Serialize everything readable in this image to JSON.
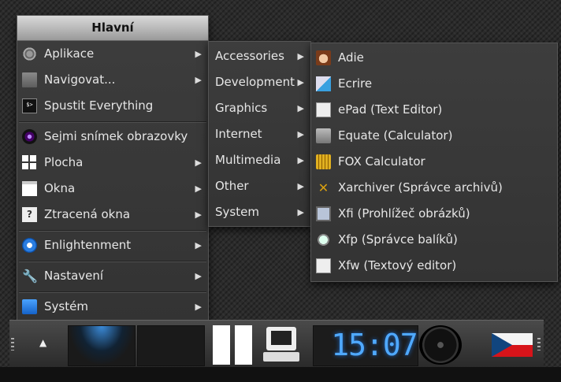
{
  "main_menu": {
    "title": "Hlavní",
    "items": [
      {
        "label": "Aplikace",
        "icon": "gear-icon",
        "submenu": true
      },
      {
        "label": "Navigovat...",
        "icon": "folder-icon",
        "submenu": true
      },
      {
        "label": "Spustit Everything",
        "icon": "terminal-icon",
        "submenu": false
      },
      {
        "label": "Sejmi snímek obrazovky",
        "icon": "camera-icon",
        "submenu": false
      },
      {
        "label": "Plocha",
        "icon": "desktop-grid-icon",
        "submenu": true
      },
      {
        "label": "Okna",
        "icon": "window-icon",
        "submenu": true
      },
      {
        "label": "Ztracená okna",
        "icon": "question-window-icon",
        "submenu": true
      },
      {
        "label": "Enlightenment",
        "icon": "enlightenment-icon",
        "submenu": true
      },
      {
        "label": "Nastavení",
        "icon": "wrench-icon",
        "submenu": true
      },
      {
        "label": "Systém",
        "icon": "system-icon",
        "submenu": true
      }
    ]
  },
  "apps_menu": {
    "items": [
      {
        "label": "Accessories"
      },
      {
        "label": "Development"
      },
      {
        "label": "Graphics"
      },
      {
        "label": "Internet"
      },
      {
        "label": "Multimedia"
      },
      {
        "label": "Other"
      },
      {
        "label": "System"
      }
    ]
  },
  "accessories_menu": {
    "items": [
      {
        "label": "Adie",
        "icon": "adie-icon"
      },
      {
        "label": "Ecrire",
        "icon": "pen-icon"
      },
      {
        "label": "ePad (Text Editor)",
        "icon": "notepad-icon"
      },
      {
        "label": "Equate (Calculator)",
        "icon": "calculator-icon"
      },
      {
        "label": "FOX Calculator",
        "icon": "fox-calculator-icon"
      },
      {
        "label": "Xarchiver (Správce archivů)",
        "icon": "archiver-icon"
      },
      {
        "label": "Xfi (Prohlížeč obrázků)",
        "icon": "image-viewer-icon"
      },
      {
        "label": "Xfp (Správce balíků)",
        "icon": "package-manager-icon"
      },
      {
        "label": "Xfw (Textový editor)",
        "icon": "text-editor-icon"
      }
    ]
  },
  "panel": {
    "clock": "15:07",
    "colors": {
      "clock": "#4fa9ff",
      "accent": "#2a7de0"
    }
  }
}
